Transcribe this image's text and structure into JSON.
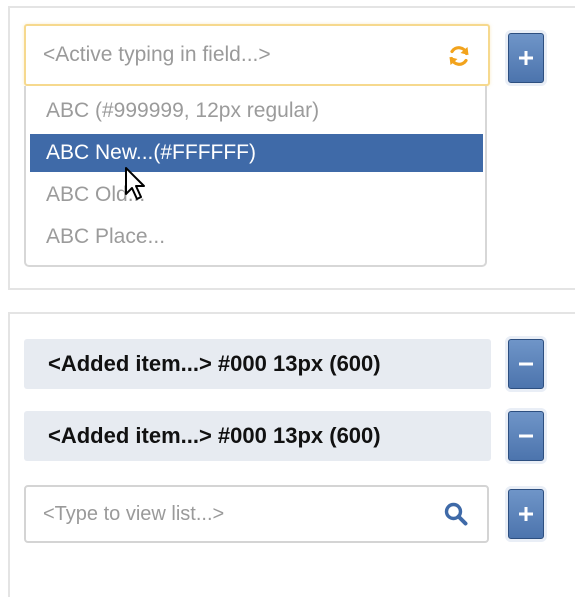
{
  "panel_top": {
    "combo_text": "<Active typing in field...>",
    "options": [
      "ABC (#999999, 12px regular)",
      "ABC New...(#FFFFFF)",
      "ABC Old...",
      "ABC Place..."
    ],
    "selected_index": 1,
    "add_button_label": "+"
  },
  "panel_bottom": {
    "added_items": [
      "<Added item...> #000 13px (600)",
      "<Added item...> #000 13px (600)"
    ],
    "remove_button_label": "−",
    "search_placeholder": "<Type to view list...>",
    "add_button_label": "+"
  },
  "colors": {
    "accent": "#4c74ad",
    "selected_bg": "#3f6aa8",
    "focus_border": "#f6d98e",
    "refresh_icon": "#f2a31c",
    "search_icon": "#3f6aa8",
    "muted_text": "#999999",
    "item_text": "#000000"
  },
  "icons": {
    "refresh": "refresh-icon",
    "search": "search-icon",
    "cursor": "arrow-cursor-icon",
    "plus": "plus-icon",
    "minus": "minus-icon"
  }
}
